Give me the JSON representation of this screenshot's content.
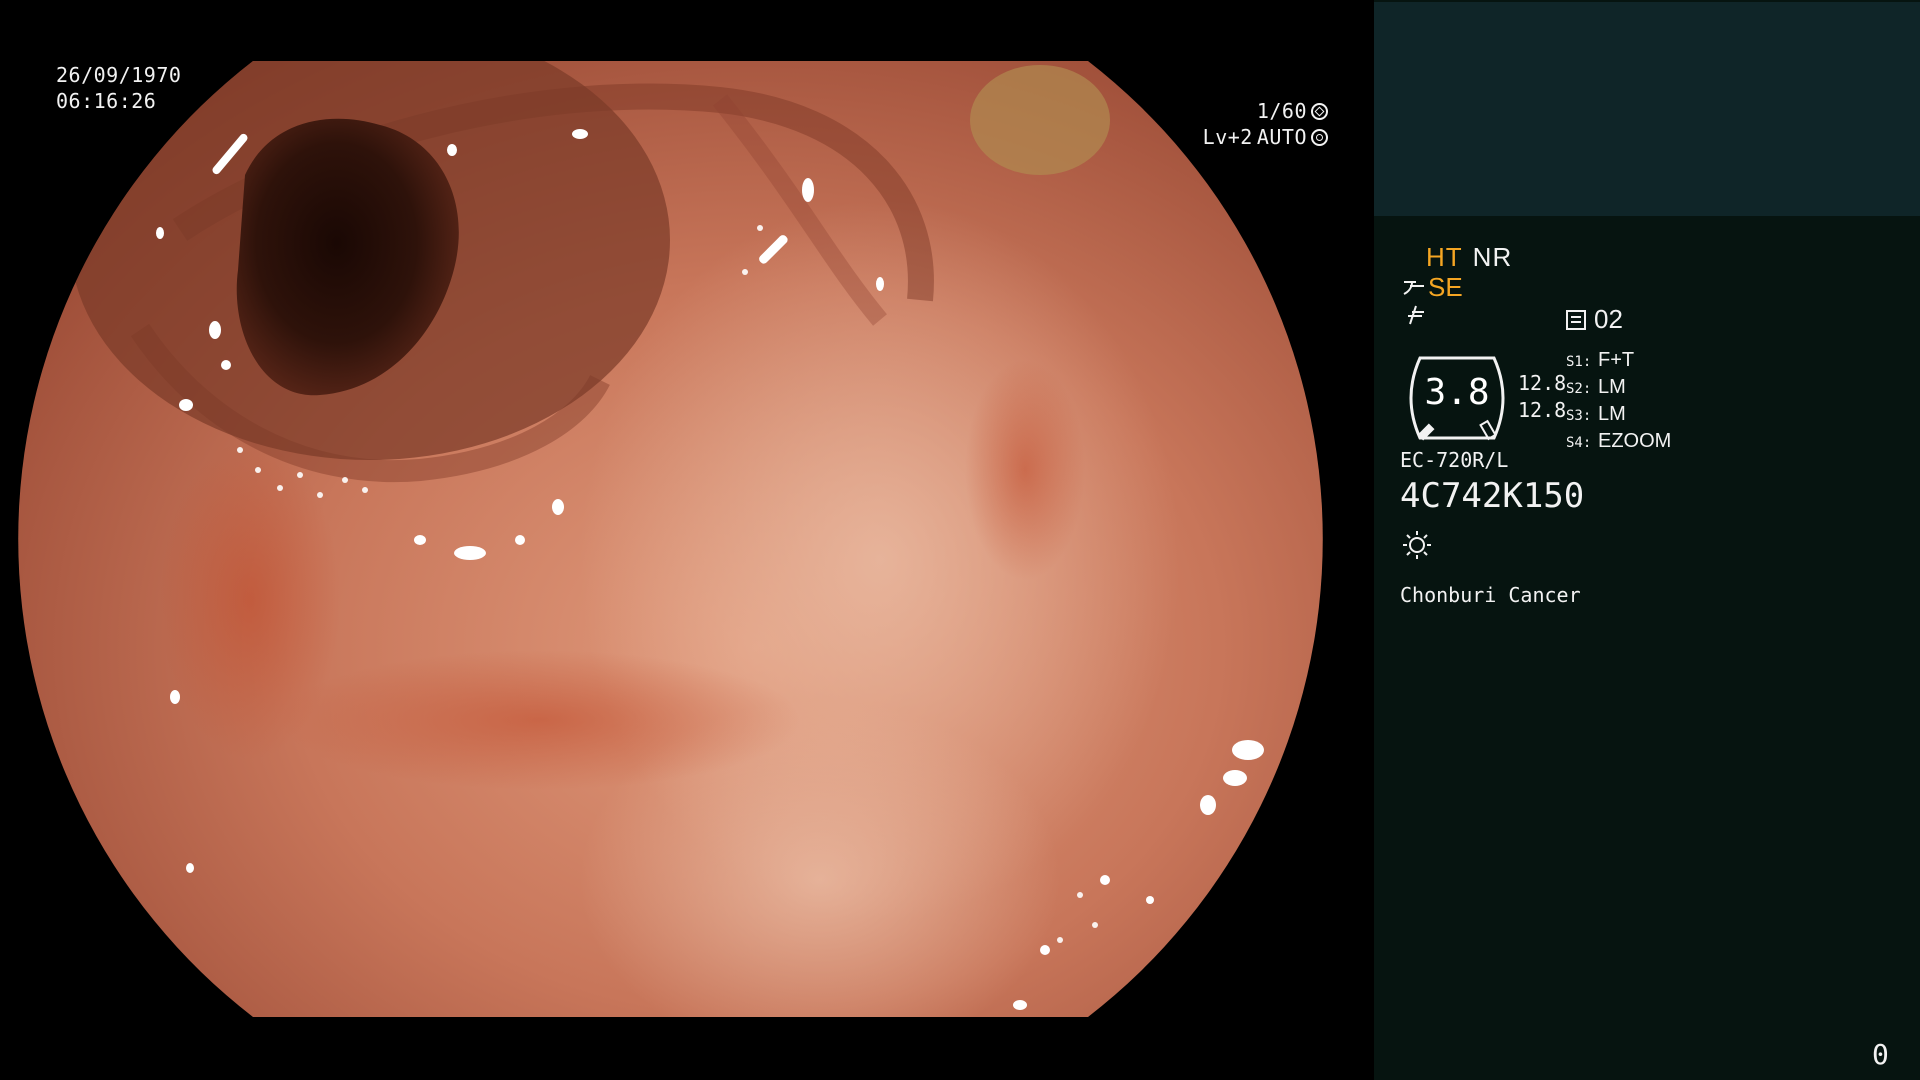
{
  "overlay": {
    "date": "26/09/1970",
    "time": "06:16:26",
    "shutter": "1/60",
    "shutter_icon": "shutter-icon",
    "level": "Lv+2",
    "iris_mode": "AUTO",
    "iris_icon": "iris-icon"
  },
  "panel": {
    "mode_ht": "HT",
    "mode_nr": "NR",
    "se_label": "SE",
    "memo_icon": "memo-icon",
    "memo_value": "02",
    "gauge_value": "3.8",
    "gauge_upper": "12.8",
    "gauge_lower": "12.8",
    "settings": [
      {
        "key": "S1:",
        "value": "F+T"
      },
      {
        "key": "S2:",
        "value": "LM"
      },
      {
        "key": "S3:",
        "value": "LM"
      },
      {
        "key": "S4:",
        "value": "EZOOM"
      }
    ],
    "model": "EC-720R/L",
    "serial": "4C742K150",
    "light_icon": "light-icon",
    "hospital": "Chonburi Cancer",
    "counter": "0"
  },
  "colors": {
    "panel_bg": "#061410",
    "panel_top_bg": "#0f2528",
    "accent_amber": "#f5a623",
    "text": "#f2f2f2",
    "mucosa": "#c8765a"
  }
}
